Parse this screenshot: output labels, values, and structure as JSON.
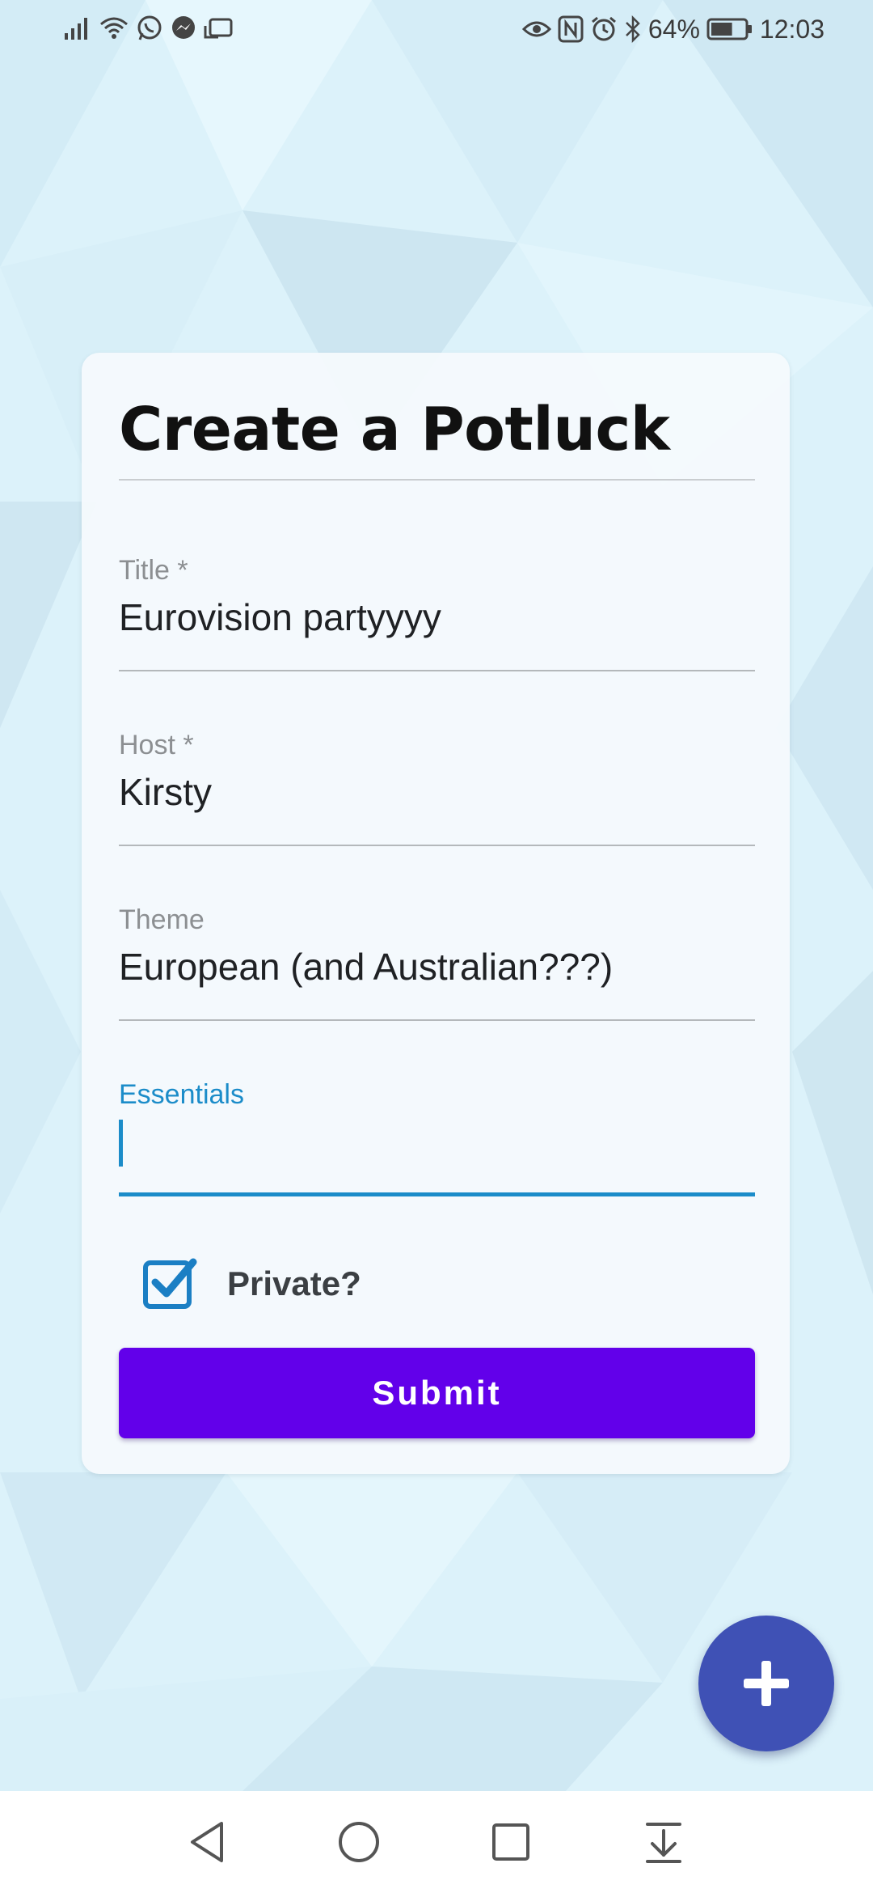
{
  "status_bar": {
    "battery_percent": "64%",
    "time": "12:03",
    "battery_level": 0.64
  },
  "form": {
    "title": "Create a Potluck",
    "fields": [
      {
        "label": "Title *",
        "value": "Eurovision partyyyy"
      },
      {
        "label": "Host *",
        "value": "Kirsty"
      },
      {
        "label": "Theme",
        "value": "European (and Australian???)"
      },
      {
        "label": "Essentials",
        "value": ""
      }
    ],
    "private_checkbox": {
      "label": "Private?",
      "checked": true
    },
    "submit_label": "Submit"
  },
  "fab": {
    "icon": "plus-icon"
  },
  "navigation": {
    "buttons": [
      "back-icon",
      "home-icon",
      "recents-icon",
      "notification-shade-icon"
    ]
  },
  "colors": {
    "accent": "#1b8cc9",
    "button": "#6200ea",
    "fab": "#3f51b5"
  }
}
